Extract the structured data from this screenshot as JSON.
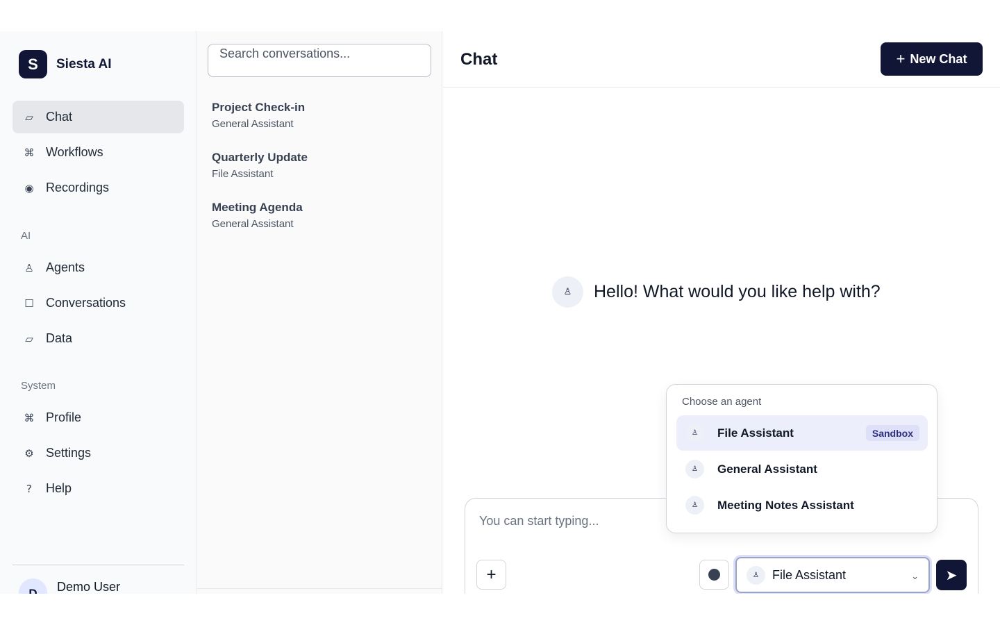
{
  "brand": {
    "logo_letter": "S",
    "name": "Siesta AI"
  },
  "sidebar": {
    "main_items": [
      {
        "label": "Chat",
        "icon": "chat-bubble-icon",
        "glyph": "▱",
        "active": true
      },
      {
        "label": "Workflows",
        "icon": "command-icon",
        "glyph": "⌘"
      },
      {
        "label": "Recordings",
        "icon": "record-icon",
        "glyph": "◉"
      }
    ],
    "ai_section_label": "AI",
    "ai_items": [
      {
        "label": "Agents",
        "icon": "agent-icon",
        "glyph": "♙"
      },
      {
        "label": "Conversations",
        "icon": "square-icon",
        "glyph": "☐"
      },
      {
        "label": "Data",
        "icon": "data-icon",
        "glyph": "▱"
      }
    ],
    "system_section_label": "System",
    "system_items": [
      {
        "label": "Profile",
        "icon": "command-icon",
        "glyph": "⌘"
      },
      {
        "label": "Settings",
        "icon": "gear-icon",
        "glyph": "⚙"
      },
      {
        "label": "Help",
        "icon": "help-icon",
        "glyph": "?"
      }
    ],
    "user": {
      "avatar_letter": "D",
      "name": "Demo User"
    }
  },
  "conversations": {
    "search_placeholder": "Search conversations...",
    "items": [
      {
        "title": "Project Check-in",
        "agent": "General Assistant"
      },
      {
        "title": "Quarterly Update",
        "agent": "File Assistant"
      },
      {
        "title": "Meeting Agenda",
        "agent": "General Assistant"
      }
    ]
  },
  "main": {
    "title": "Chat",
    "new_chat_icon": "+",
    "new_chat_label": "New Chat",
    "agent_glyph": "♙",
    "greeting": "Hello! What would you like help with?",
    "composer": {
      "placeholder": "You can start typing...",
      "attach_glyph": "+",
      "selected_agent": "File Assistant",
      "chevron": "⌄",
      "send_glyph": "➤"
    }
  },
  "agent_dropdown": {
    "title": "Choose an agent",
    "items": [
      {
        "label": "File Assistant",
        "badge": "Sandbox",
        "selected": true
      },
      {
        "label": "General Assistant"
      },
      {
        "label": "Meeting Notes Assistant"
      }
    ]
  },
  "colors": {
    "brand_navy": "#111636",
    "sidebar_bg": "#f9fafb",
    "active_item_bg": "#e5e7eb",
    "dropdown_selected_bg": "#eceefc",
    "badge_bg": "#dde0f7"
  }
}
